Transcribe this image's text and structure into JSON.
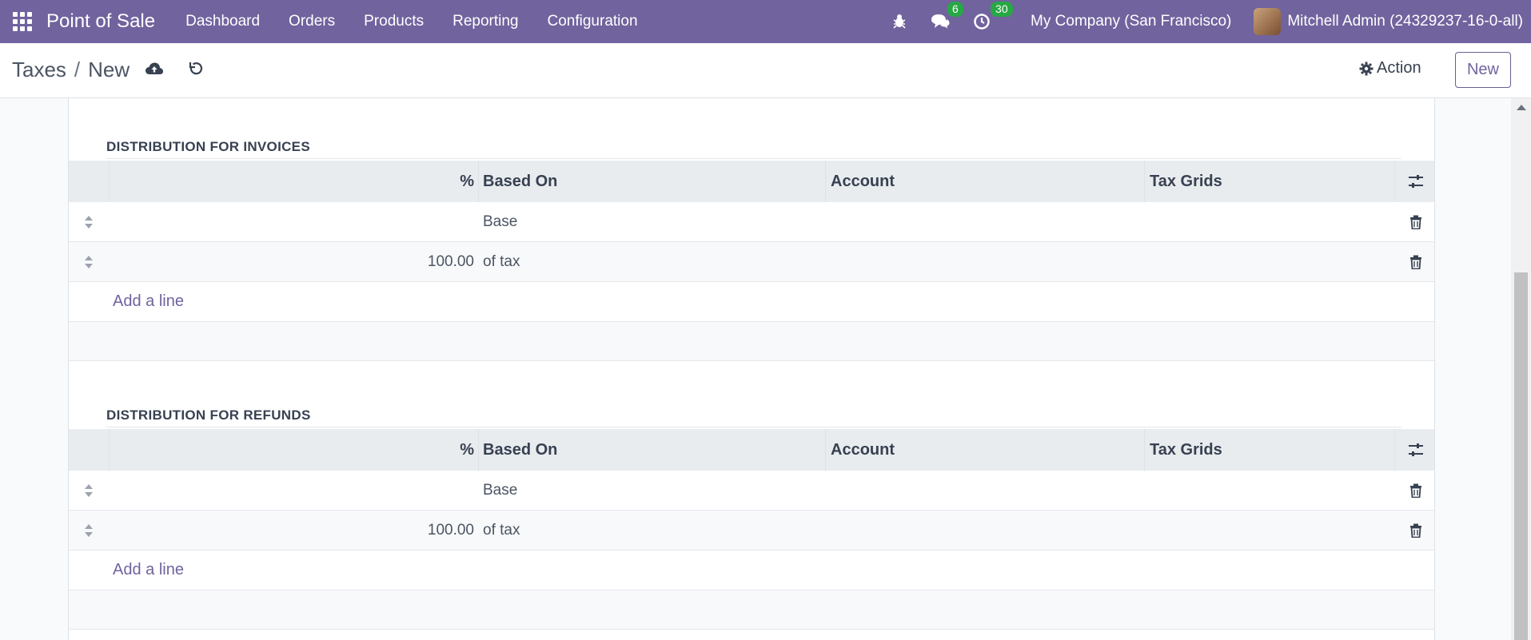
{
  "navbar": {
    "brand": "Point of Sale",
    "menu": [
      "Dashboard",
      "Orders",
      "Products",
      "Reporting",
      "Configuration"
    ],
    "messages_count": "6",
    "activities_count": "30",
    "company": "My Company (San Francisco)",
    "user": "Mitchell Admin (24329237-16-0-all)"
  },
  "control": {
    "breadcrumb_parent": "Taxes",
    "breadcrumb_sep": "/",
    "breadcrumb_current": "New",
    "action_label": "Action",
    "new_label": "New"
  },
  "invoices": {
    "title": "DISTRIBUTION FOR INVOICES",
    "headers": {
      "percent": "%",
      "based_on": "Based On",
      "account": "Account",
      "tax_grids": "Tax Grids"
    },
    "rows": [
      {
        "percent": "",
        "based_on": "Base"
      },
      {
        "percent": "100.00",
        "based_on": "of tax"
      }
    ],
    "add_line": "Add a line"
  },
  "refunds": {
    "title": "DISTRIBUTION FOR REFUNDS",
    "headers": {
      "percent": "%",
      "based_on": "Based On",
      "account": "Account",
      "tax_grids": "Tax Grids"
    },
    "rows": [
      {
        "percent": "",
        "based_on": "Base"
      },
      {
        "percent": "100.00",
        "based_on": "of tax"
      }
    ],
    "add_line": "Add a line"
  },
  "colors": {
    "brand": "#71639e",
    "badge": "#28a745"
  }
}
